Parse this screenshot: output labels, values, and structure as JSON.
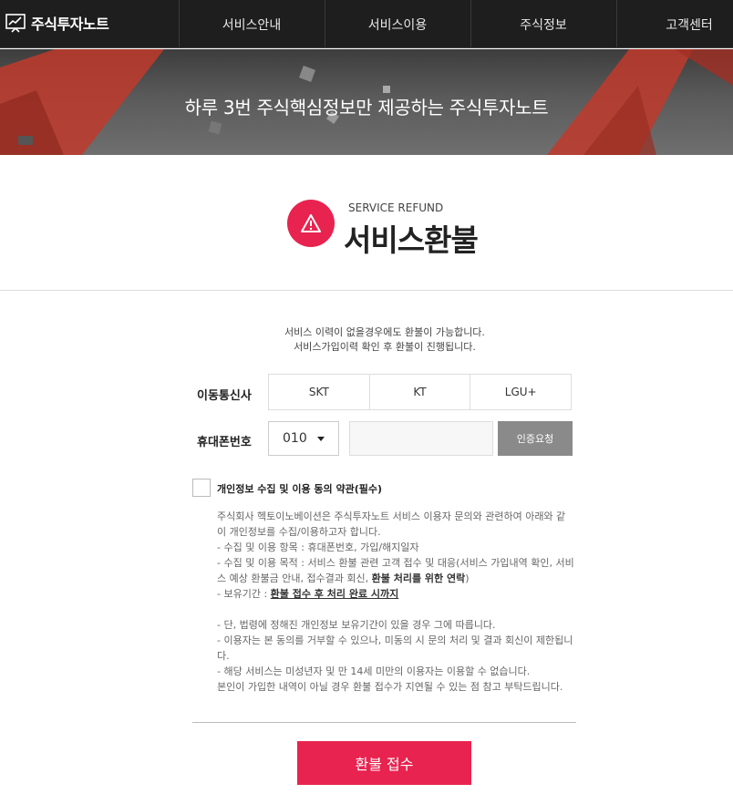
{
  "header": {
    "logo_text": "주식투자노트",
    "nav": [
      "서비스안내",
      "서비스이용",
      "주식정보",
      "고객센터"
    ]
  },
  "hero": {
    "tagline": "하루 3번 주식핵심정보만 제공하는 주식투자노트"
  },
  "title": {
    "sub": "SERVICE REFUND",
    "main": "서비스환불"
  },
  "notice": {
    "line1": "서비스 이력이 없을경우에도 환불이 가능합니다.",
    "line2": "서비스가입이력 확인 후 환불이 진행됩니다."
  },
  "form": {
    "carrier_label": "이동통신사",
    "carriers": [
      "SKT",
      "KT",
      "LGU+"
    ],
    "phone_label": "휴대폰번호",
    "phone_prefix": "010",
    "phone_value": "",
    "verify_button": "인증요청"
  },
  "agreement": {
    "label": "개인정보 수집 및 이용 동의 약관(필수)",
    "p1": "주식회사 헥토이노베이션은 주식투자노트 서비스 이용자 문의와 관련하여 아래와 같이 개인정보를 수집/이용하고자 합니다.",
    "item1_prefix": "- 수집 및 이용 항목 : ",
    "item1_value": "휴대폰번호, 가입/해지일자",
    "item2_prefix": "- 수집 및 이용 목적 : 서비스 환불 관련 고객 접수 및 대응(서비스 가입내역 확인, 서비스 예상 환불금 안내, 접수결과 회신, ",
    "item2_bold": "환불 처리를 위한 연락",
    "item2_suffix": ")",
    "item3_prefix": "- 보유기간 : ",
    "item3_value": "환불 접수 후 처리 완료 시까지",
    "note1": "- 단, 법령에 정해진 개인정보 보유기간이 있을 경우 그에 따릅니다.",
    "note2": "- 이용자는 본 동의를 거부할 수 있으나, 미동의 시 문의 처리 및 결과 회신이 제한됩니다.",
    "note3": "- 해당 서비스는 미성년자 및 만 14세 미만의 이용자는 이용할 수 없습니다.",
    "note4": "본인이 가입한 내역이 아닐 경우 환불 접수가 지연될 수 있는 점 참고 부탁드립니다."
  },
  "submit_button": "환불 접수",
  "colors": {
    "accent": "#e8234f",
    "nav_bg": "#1e1e1e",
    "verify_bg": "#8a8a8a"
  }
}
